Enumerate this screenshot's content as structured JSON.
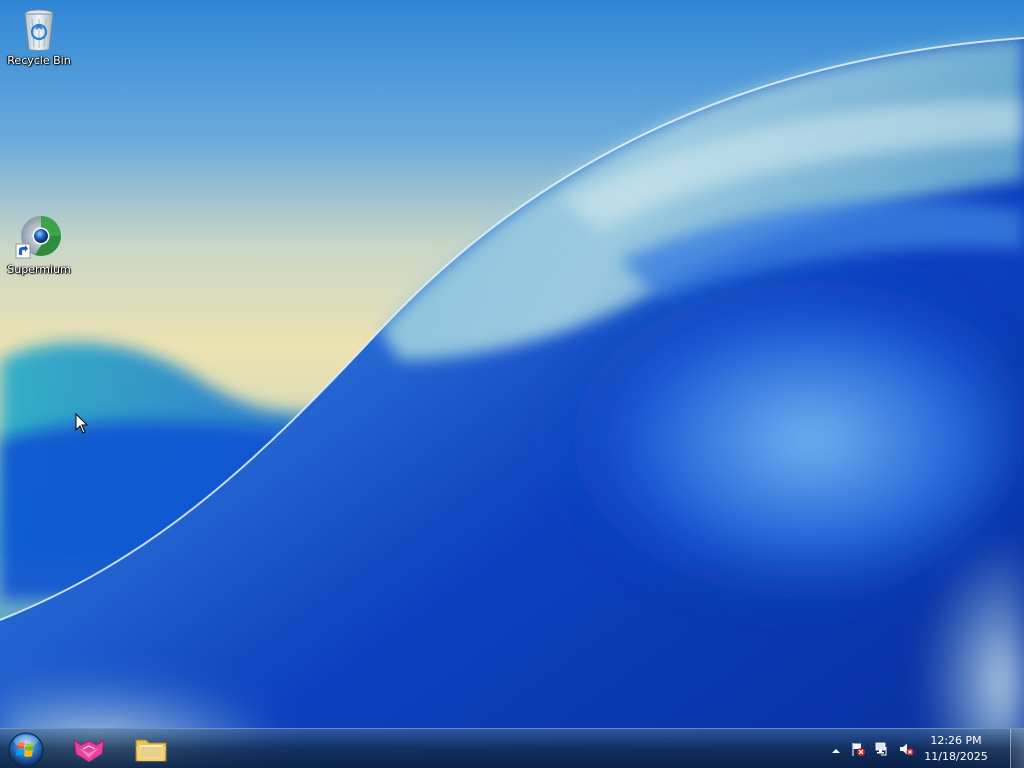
{
  "desktop": {
    "icons": [
      {
        "label": "Recycle Bin",
        "icon": "recycle-bin-icon"
      },
      {
        "label": "Supermium",
        "icon": "supermium-browser-icon"
      }
    ]
  },
  "taskbar": {
    "start_icon": "windows-start-orb-icon",
    "pinned_apps": [
      {
        "icon": "pink-cat-app-icon"
      },
      {
        "icon": "file-explorer-folder-icon"
      }
    ],
    "tray": {
      "show_hidden_icon": "chevron-up-icon",
      "icons": [
        "action-center-flag-icon",
        "network-disconnected-icon",
        "volume-muted-icon"
      ]
    },
    "clock": {
      "time": "12:26 PM",
      "date": "11/18/2025"
    }
  },
  "colors": {
    "sky_top": "#2e86d4",
    "sky_mid": "#e9e2b8",
    "wave_blue": "#0b44c8",
    "taskbar": "#1b3a5c"
  }
}
